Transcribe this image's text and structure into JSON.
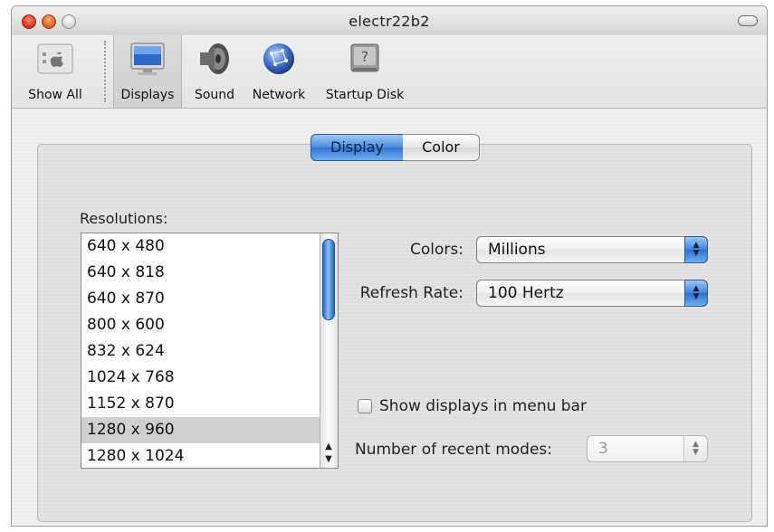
{
  "window": {
    "title": "electr22b2"
  },
  "toolbar": {
    "show_all": "Show All",
    "displays": "Displays",
    "sound": "Sound",
    "network": "Network",
    "startup_disk": "Startup Disk"
  },
  "tabs": {
    "display": "Display",
    "color": "Color",
    "selected": "Display"
  },
  "resolutions": {
    "label": "Resolutions:",
    "items": [
      "640 x 480",
      "640 x 818",
      "640 x 870",
      "800 x 600",
      "832 x 624",
      "1024 x 768",
      "1152 x 870",
      "1280 x 960",
      "1280 x 1024"
    ],
    "selected": "1280 x 960"
  },
  "settings": {
    "colors_label": "Colors:",
    "colors_value": "Millions",
    "refresh_label": "Refresh Rate:",
    "refresh_value": "100 Hertz",
    "show_displays_label": "Show displays in menu bar",
    "show_displays_checked": false,
    "recent_modes_label": "Number of recent modes:",
    "recent_modes_value": "3"
  },
  "colors": {
    "accent": "#3d83db",
    "selection": "#cfcfcf"
  }
}
